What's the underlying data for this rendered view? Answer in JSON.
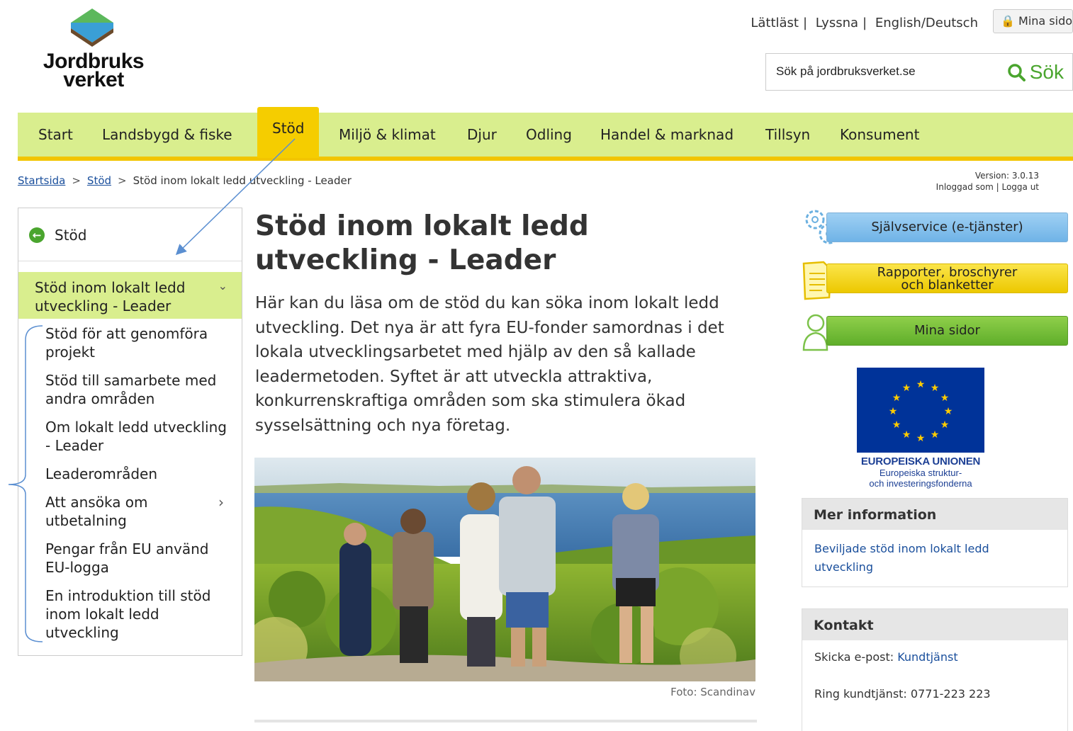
{
  "logo": {
    "line1": "Jordbruks",
    "line2": "verket"
  },
  "utility": {
    "lattlast": "Lättläst",
    "lyssna": "Lyssna",
    "english": "English/Deutsch",
    "sep": "|",
    "mina_sidor": "Mina sidor"
  },
  "search": {
    "placeholder": "Sök på jordbruksverket.se",
    "button": "Sök"
  },
  "nav": {
    "items": [
      "Start",
      "Landsbygd & fiske",
      "Stöd",
      "Miljö & klimat",
      "Djur",
      "Odling",
      "Handel & marknad",
      "Tillsyn",
      "Konsument"
    ],
    "active": "Stöd"
  },
  "breadcrumb": {
    "items": [
      "Startsida",
      "Stöd",
      "Stöd inom lokalt ledd utveckling - Leader"
    ],
    "sep": ">"
  },
  "version": {
    "line1": "Version: 3.0.13",
    "logged_in": "Inloggad som",
    "logout": "Logga ut"
  },
  "leftnav": {
    "back": "Stöd",
    "active": "Stöd inom lokalt ledd utveckling - Leader",
    "items": [
      "Stöd för att genomföra projekt",
      "Stöd till samarbete med andra områden",
      "Om lokalt ledd utveckling - Leader",
      "Leaderområden",
      "Att ansöka om utbetalning",
      "Pengar från EU använd EU-logga",
      "En introduktion till stöd inom lokalt ledd utveckling"
    ]
  },
  "main": {
    "title": "Stöd inom lokalt ledd utveckling - Leader",
    "intro": "Här kan du läsa om de stöd du kan söka inom lokalt ledd utveckling. Det nya är att fyra EU-fonder samordnas i det lokala utvecklingsarbetet med hjälp av den så kallade leadermetoden. Syftet är att utveckla attraktiva, konkurrenskraftiga områden som ska stimulera ökad sysselsättning och nya företag.",
    "caption": "Foto: Scandinav"
  },
  "right": {
    "selfservice": "Självservice (e-tjänster)",
    "reports_1": "Rapporter, broschyrer",
    "reports_2": "och blanketter",
    "mina_sidor": "Mina sidor",
    "eu_1": "EUROPEISKA UNIONEN",
    "eu_2": "Europeiska struktur-",
    "eu_3": "och investeringsfonderna",
    "mer_info": "Mer information",
    "mer_info_link": "Beviljade stöd inom lokalt ledd utveckling",
    "kontakt": "Kontakt",
    "email_label": "Skicka e-post:",
    "email_link": "Kundtjänst",
    "phone": "Ring kundtjänst: 0771-223 223"
  },
  "colors": {
    "nav_bg": "#d9ee8e",
    "nav_active": "#f5cd00",
    "accent_green": "#4aa52e",
    "link": "#1a4f9c",
    "eu_blue": "#003399"
  }
}
